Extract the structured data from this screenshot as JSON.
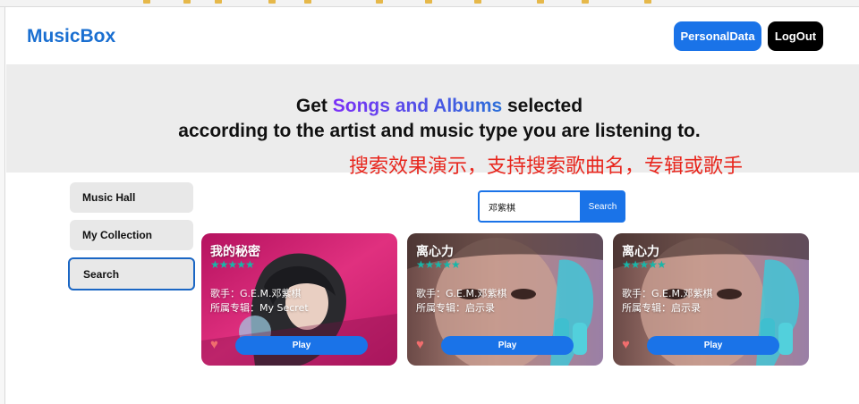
{
  "app": {
    "brand": "MusicBox"
  },
  "header": {
    "personal_label": "PersonalData",
    "logout_label": "LogOut"
  },
  "hero": {
    "line1_prefix": "Get ",
    "line1_highlight": "Songs and Albums",
    "line1_suffix": " selected",
    "line2": "according to the artist and music type you are listening to."
  },
  "annotation": {
    "text": "搜索效果演示，支持搜索歌曲名，专辑或歌手"
  },
  "sidebar": {
    "items": [
      {
        "label": "Music Hall"
      },
      {
        "label": "My Collection"
      },
      {
        "label": "Search"
      }
    ]
  },
  "search": {
    "value": "邓紫棋",
    "button_label": "Search"
  },
  "cards": [
    {
      "title": "我的秘密",
      "stars": "★★★★★",
      "singer": "歌手：G.E.M.邓紫棋",
      "album": "所属专辑：My Secret",
      "heart": "♥",
      "play_label": "Play"
    },
    {
      "title": "离心力",
      "stars": "★★★★★",
      "singer": "歌手：G.E.M.邓紫棋",
      "album": "所属专辑：启示录",
      "heart": "♥",
      "play_label": "Play"
    },
    {
      "title": "离心力",
      "stars": "★★★★★",
      "singer": "歌手：G.E.M.邓紫棋",
      "album": "所属专辑：启示录",
      "heart": "♥",
      "play_label": "Play"
    }
  ],
  "colors": {
    "accent": "#1a73e8",
    "brand": "#1a6fd1",
    "annotation": "#e8261d",
    "star": "#18b6a8",
    "heart": "#f06d6d"
  }
}
